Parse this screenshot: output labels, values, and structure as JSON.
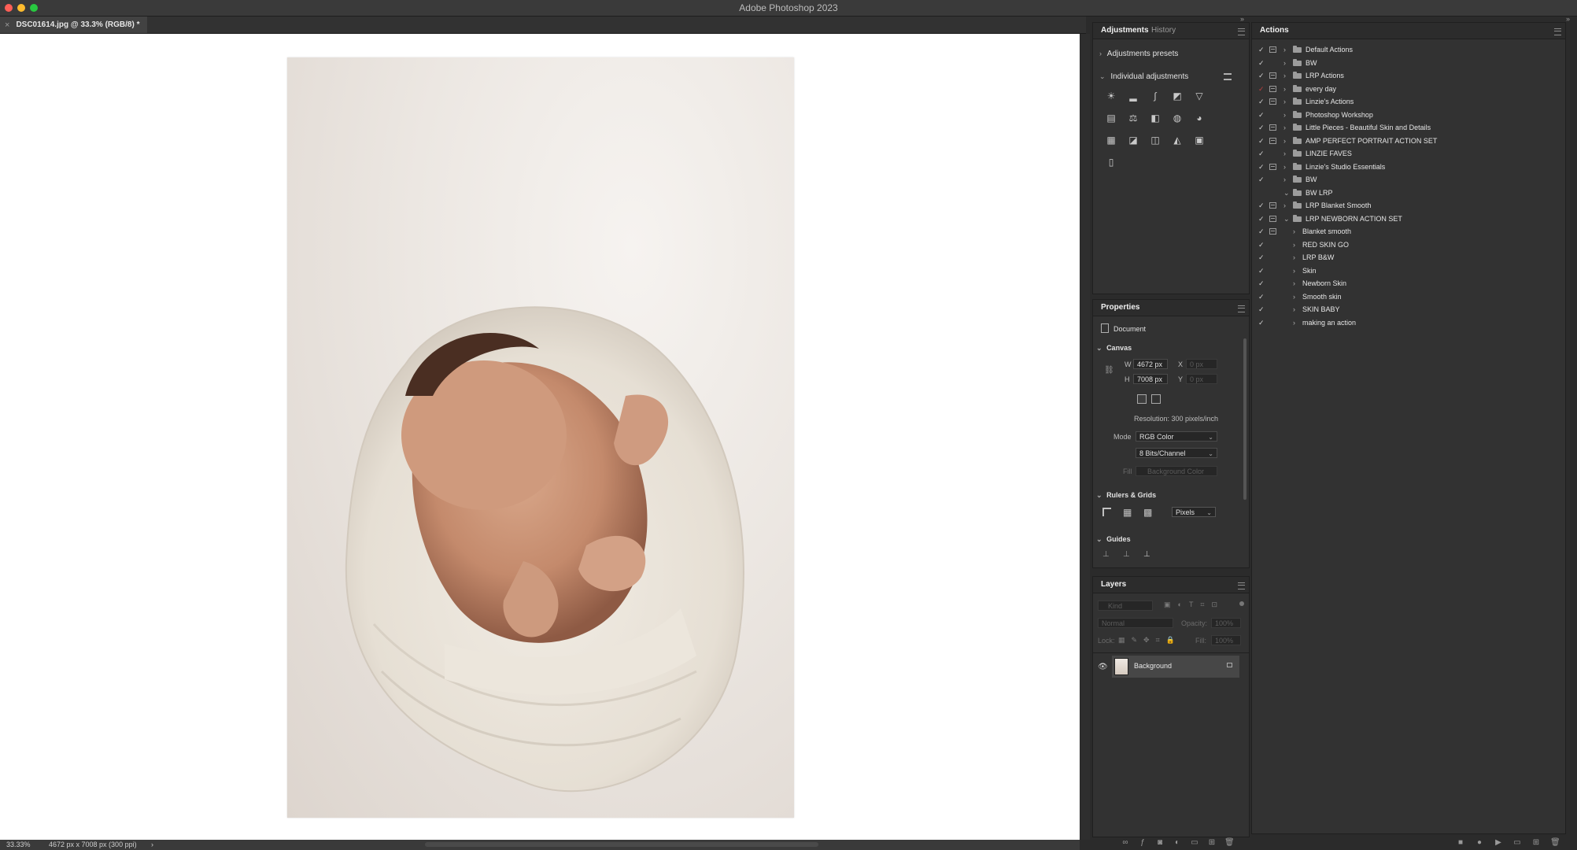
{
  "window": {
    "title": "Adobe Photoshop 2023"
  },
  "document": {
    "tab_title": "DSC01614.jpg @ 33.3% (RGB/8) *",
    "close_glyph": "×"
  },
  "status_bar": {
    "zoom": "33.33%",
    "doc_info": "4672 px x 7008 px (300 ppi)",
    "arrow": "›"
  },
  "adjustments_panel": {
    "tabs": [
      "Adjustments",
      "History"
    ],
    "presets_label": "Adjustments presets",
    "individual_label": "Individual adjustments",
    "icons": [
      "brightness-contrast-icon",
      "levels-icon",
      "curves-icon",
      "exposure-icon",
      "vibrance-icon",
      "hue-saturation-icon",
      "color-balance-icon",
      "black-white-icon",
      "photo-filter-icon",
      "channel-mixer-icon",
      "color-lookup-icon",
      "invert-icon",
      "posterize-icon",
      "threshold-icon",
      "selective-color-icon",
      "gradient-map-icon"
    ]
  },
  "properties_panel": {
    "title": "Properties",
    "document_label": "Document",
    "canvas_label": "Canvas",
    "w_label": "W",
    "w_value": "4672 px",
    "h_label": "H",
    "h_value": "7008 px",
    "x_label": "X",
    "x_value": "0 px",
    "y_label": "Y",
    "y_value": "0 px",
    "resolution": "Resolution: 300 pixels/inch",
    "mode_label": "Mode",
    "mode_value": "RGB Color",
    "depth_value": "8 Bits/Channel",
    "fill_label": "Fill",
    "fill_value": "Background Color",
    "rulers_label": "Rulers & Grids",
    "units_value": "Pixels",
    "guides_label": "Guides"
  },
  "layers_panel": {
    "title": "Layers",
    "kind_placeholder": "Kind",
    "blend_mode": "Normal",
    "opacity_label": "Opacity:",
    "opacity_value": "100%",
    "lock_label": "Lock:",
    "fill_label": "Fill:",
    "fill_value": "100%",
    "layer_name": "Background"
  },
  "actions_panel": {
    "title": "Actions",
    "rows": [
      {
        "label": "Default Actions",
        "level": 0,
        "folder": true,
        "dialog": true,
        "expanded": false,
        "check_red": false
      },
      {
        "label": "BW",
        "level": 0,
        "folder": true,
        "dialog": false,
        "expanded": false,
        "check_red": false
      },
      {
        "label": "LRP Actions",
        "level": 0,
        "folder": true,
        "dialog": true,
        "expanded": false,
        "check_red": false
      },
      {
        "label": "every day",
        "level": 0,
        "folder": true,
        "dialog": true,
        "expanded": false,
        "check_red": true
      },
      {
        "label": "Linzie's Actions",
        "level": 0,
        "folder": true,
        "dialog": true,
        "expanded": false,
        "check_red": false
      },
      {
        "label": "Photoshop Workshop",
        "level": 0,
        "folder": true,
        "dialog": false,
        "expanded": false,
        "check_red": false
      },
      {
        "label": "Little Pieces - Beautiful Skin and Details",
        "level": 0,
        "folder": true,
        "dialog": true,
        "expanded": false,
        "check_red": false
      },
      {
        "label": "AMP PERFECT PORTRAIT ACTION SET",
        "level": 0,
        "folder": true,
        "dialog": true,
        "expanded": false,
        "check_red": false
      },
      {
        "label": "LINZIE FAVES",
        "level": 0,
        "folder": true,
        "dialog": false,
        "expanded": false,
        "check_red": false
      },
      {
        "label": "Linzie's Studio Essentials",
        "level": 0,
        "folder": true,
        "dialog": true,
        "expanded": false,
        "check_red": false
      },
      {
        "label": "BW",
        "level": 0,
        "folder": true,
        "dialog": false,
        "expanded": false,
        "check_red": false
      },
      {
        "label": "BW LRP",
        "level": 0,
        "folder": true,
        "dialog": false,
        "expanded": true,
        "check_red": false,
        "no_check": true
      },
      {
        "label": "LRP Blanket Smooth",
        "level": 0,
        "folder": true,
        "dialog": true,
        "expanded": false,
        "check_red": false
      },
      {
        "label": "LRP NEWBORN ACTION SET",
        "level": 0,
        "folder": true,
        "dialog": true,
        "expanded": true,
        "check_red": false
      },
      {
        "label": "Blanket smooth",
        "level": 1,
        "folder": false,
        "dialog": true,
        "expanded": false,
        "check_red": false
      },
      {
        "label": "RED SKIN GO",
        "level": 1,
        "folder": false,
        "dialog": false,
        "expanded": false,
        "check_red": false
      },
      {
        "label": "LRP B&W",
        "level": 1,
        "folder": false,
        "dialog": false,
        "expanded": false,
        "check_red": false
      },
      {
        "label": "Skin",
        "level": 1,
        "folder": false,
        "dialog": false,
        "expanded": false,
        "check_red": false
      },
      {
        "label": "Newborn Skin",
        "level": 1,
        "folder": false,
        "dialog": false,
        "expanded": false,
        "check_red": false
      },
      {
        "label": "Smooth skin",
        "level": 1,
        "folder": false,
        "dialog": false,
        "expanded": false,
        "check_red": false
      },
      {
        "label": "SKIN BABY",
        "level": 1,
        "folder": false,
        "dialog": false,
        "expanded": false,
        "check_red": false
      },
      {
        "label": "making an action",
        "level": 1,
        "folder": false,
        "dialog": false,
        "expanded": false,
        "check_red": false
      }
    ]
  },
  "colors": {
    "window_bg": "#2b2b2b",
    "panel_bg": "#323232",
    "canvas_bg": "#ffffff",
    "red_light": "#fe5f57",
    "yellow_light": "#febc2e",
    "green_light": "#28c840"
  }
}
